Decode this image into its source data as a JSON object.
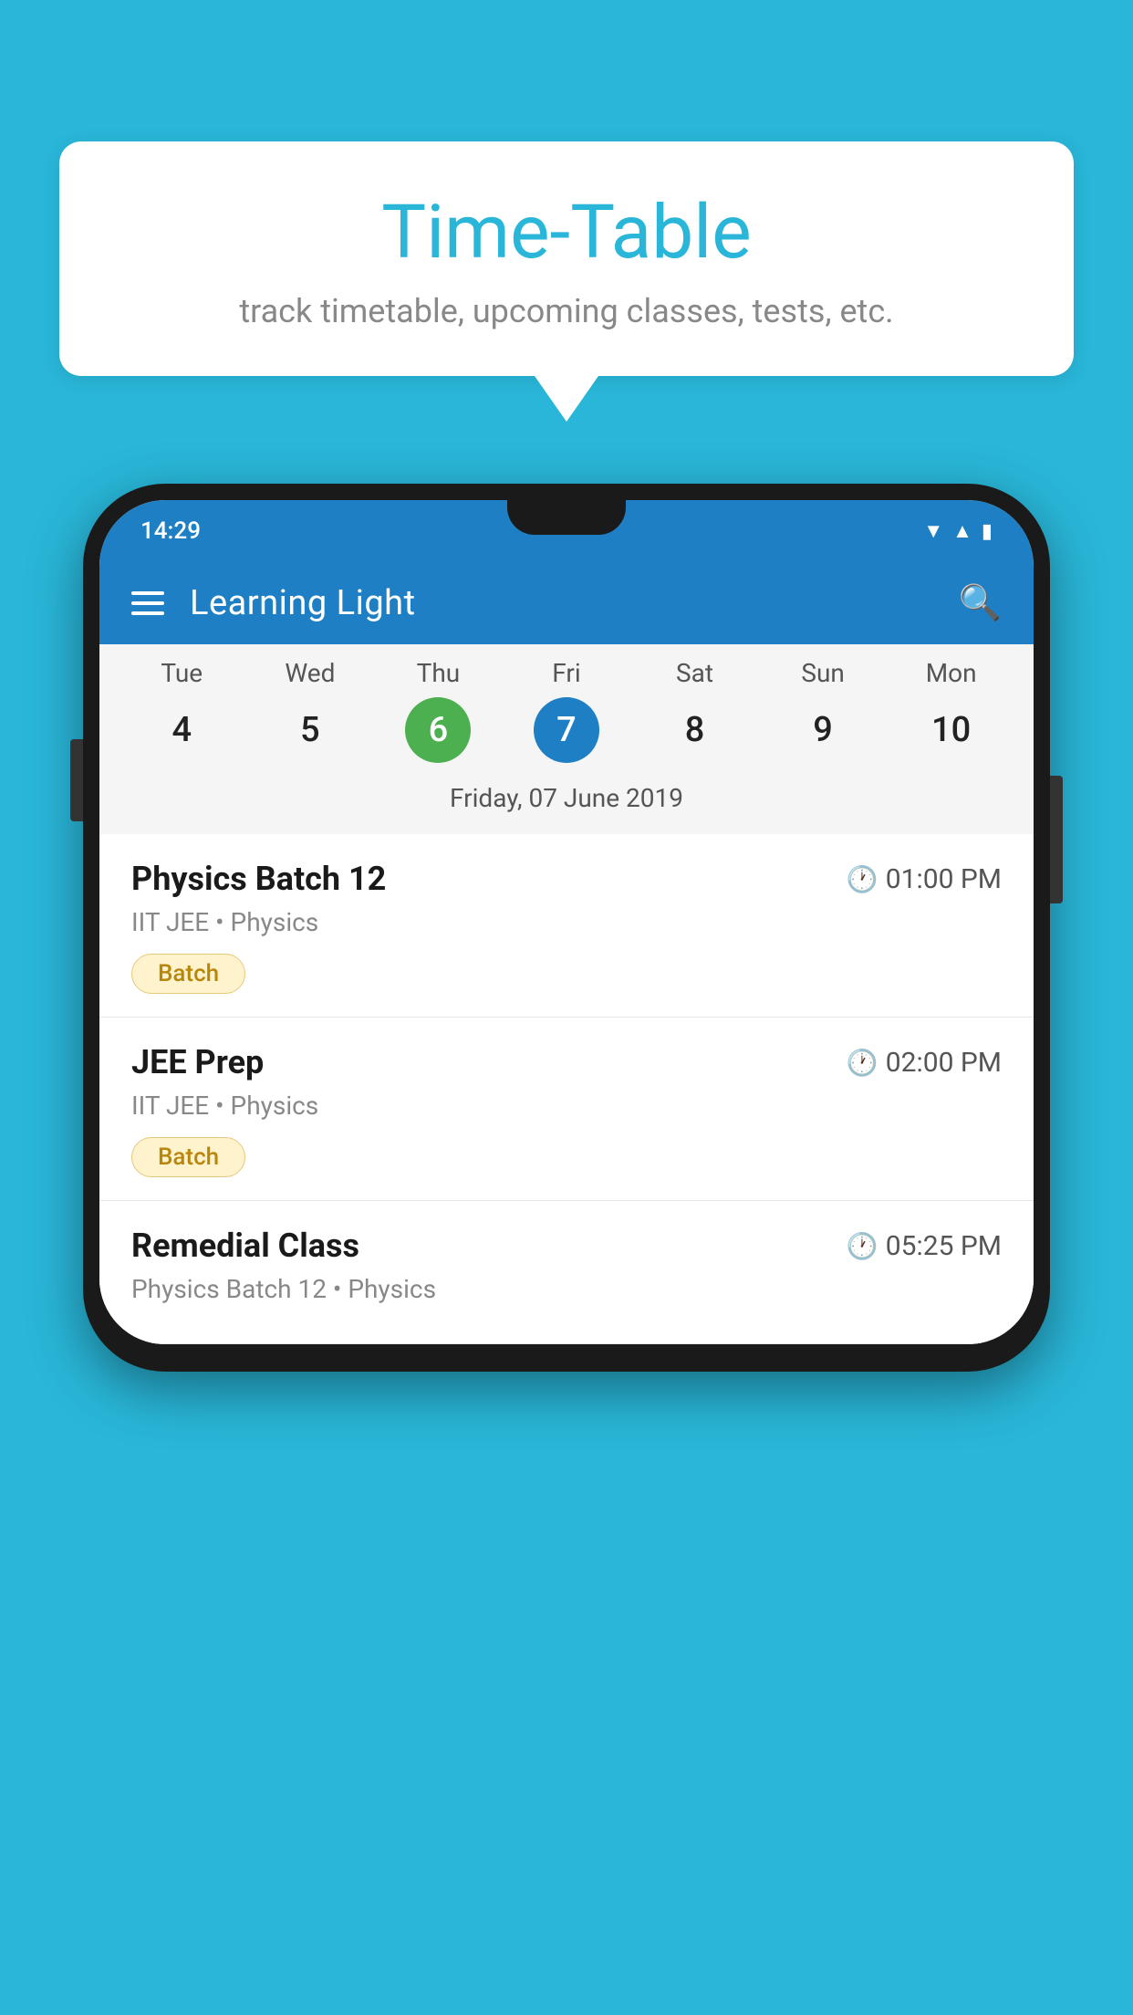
{
  "background_color": "#29b6d8",
  "speech_bubble": {
    "title": "Time-Table",
    "subtitle": "track timetable, upcoming classes, tests, etc."
  },
  "phone": {
    "status_bar": {
      "time": "14:29"
    },
    "toolbar": {
      "title": "Learning Light",
      "menu_icon_label": "menu-icon",
      "search_icon_label": "search-icon"
    },
    "calendar": {
      "days": [
        {
          "name": "Tue",
          "num": "4",
          "state": "normal"
        },
        {
          "name": "Wed",
          "num": "5",
          "state": "normal"
        },
        {
          "name": "Thu",
          "num": "6",
          "state": "today"
        },
        {
          "name": "Fri",
          "num": "7",
          "state": "selected"
        },
        {
          "name": "Sat",
          "num": "8",
          "state": "normal"
        },
        {
          "name": "Sun",
          "num": "9",
          "state": "normal"
        },
        {
          "name": "Mon",
          "num": "10",
          "state": "normal"
        }
      ],
      "selected_date_label": "Friday, 07 June 2019"
    },
    "schedule": [
      {
        "name": "Physics Batch 12",
        "time": "01:00 PM",
        "sub": "IIT JEE • Physics",
        "tag": "Batch"
      },
      {
        "name": "JEE Prep",
        "time": "02:00 PM",
        "sub": "IIT JEE • Physics",
        "tag": "Batch"
      },
      {
        "name": "Remedial Class",
        "time": "05:25 PM",
        "sub": "Physics Batch 12 • Physics",
        "tag": ""
      }
    ]
  }
}
